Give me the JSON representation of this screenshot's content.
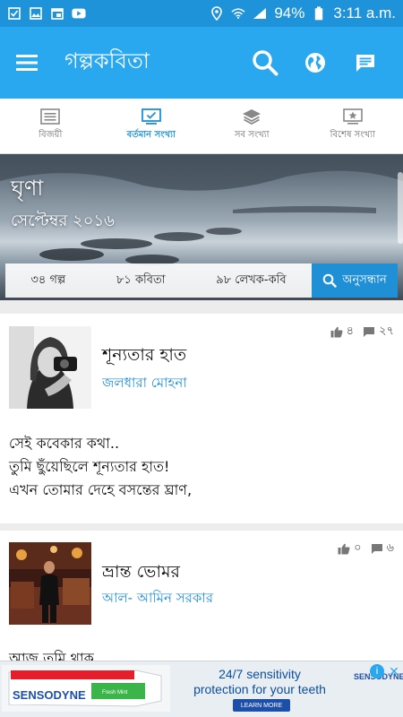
{
  "statusbar": {
    "battery": "94%",
    "time": "3:11 a.m.",
    "left_icons": [
      "check-square-icon",
      "image-icon",
      "calendar-icon",
      "youtube-icon"
    ],
    "right_icons": [
      "location-icon",
      "wifi-icon",
      "signal-icon",
      "battery-icon"
    ]
  },
  "appbar": {
    "title": "গল্পকবিতা",
    "actions": [
      "search-icon",
      "globe-icon",
      "message-icon"
    ],
    "color": "#29a8f0"
  },
  "tabs": [
    {
      "label": "বিজয়ী",
      "icon": "list-icon",
      "active": false
    },
    {
      "label": "বর্তমান সংখ্যা",
      "icon": "monitor-icon",
      "active": true
    },
    {
      "label": "সব সংখ্যা",
      "icon": "layers-icon",
      "active": false
    },
    {
      "label": "বিশেষ সংখ্যা",
      "icon": "star-image-icon",
      "active": false
    }
  ],
  "hero": {
    "title": "ঘৃণা",
    "subtitle": "সেপ্টেম্বর ২০১৬",
    "stats": {
      "stories": "৩৪ গল্প",
      "poems": "৮১ কবিতা",
      "writers": "৯৮ লেখক-কবি"
    },
    "search_label": "অনুসন্ধান"
  },
  "stories": [
    {
      "title": "শূন্যতার হাত",
      "author": "জলধারা মোহনা",
      "likes": "৪",
      "comments": "২৭",
      "excerpt": [
        "সেই কবেকার কথা..",
        "তুমি ছুঁয়েছিলে শূন্যতার হাত!",
        "এখন তোমার দেহে বসন্তের ঘ্রাণ,"
      ]
    },
    {
      "title": "ভ্রান্ত ভোমর",
      "author": "আল- আমিন সরকার",
      "likes": "০",
      "comments": "৬",
      "excerpt": [
        "আজ তুমি থাক"
      ]
    }
  ],
  "ad": {
    "line1": "24/7 sensitivity",
    "line2": "protection for your teeth",
    "cta": "LEARN MORE",
    "brand": "SENSODYNE",
    "product_label": "Fresh Mint",
    "info": "i",
    "close": "✕"
  },
  "colors": {
    "accent": "#1f8fd6",
    "statusbar": "#1f93d9"
  }
}
